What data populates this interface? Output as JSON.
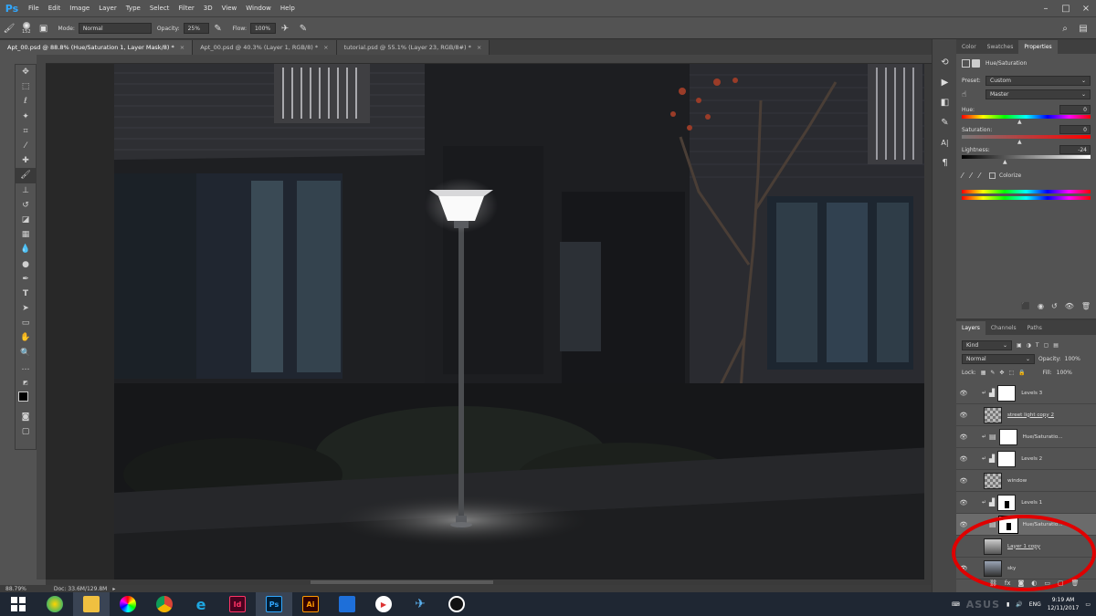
{
  "menubar": {
    "logo": "Ps",
    "items": [
      "File",
      "Edit",
      "Image",
      "Layer",
      "Type",
      "Select",
      "Filter",
      "3D",
      "View",
      "Window",
      "Help"
    ]
  },
  "options": {
    "brush_size": "152",
    "mode_label": "Mode:",
    "mode_value": "Normal",
    "opacity_label": "Opacity:",
    "opacity_value": "25%",
    "flow_label": "Flow:",
    "flow_value": "100%"
  },
  "tabs": [
    {
      "label": "Apt_00.psd @ 88.8% (Hue/Saturation 1, Layer Mask/8) *",
      "active": true
    },
    {
      "label": "Apt_00.psd @ 40.3% (Layer 1, RGB/8) *",
      "active": false
    },
    {
      "label": "tutorial.psd @ 55.1% (Layer 23, RGB/8#) *",
      "active": false
    }
  ],
  "status": {
    "zoom": "88.79%",
    "doc": "Doc: 33.6M/129.8M"
  },
  "properties": {
    "tabs": [
      "Color",
      "Swatches",
      "Properties"
    ],
    "title": "Hue/Saturation",
    "preset_label": "Preset:",
    "preset_value": "Custom",
    "channel_value": "Master",
    "hue_label": "Hue:",
    "hue_value": "0",
    "saturation_label": "Saturation:",
    "saturation_value": "0",
    "lightness_label": "Lightness:",
    "lightness_value": "-24",
    "colorize_label": "Colorize"
  },
  "layers_panel": {
    "tabs": [
      "Layers",
      "Channels",
      "Paths"
    ],
    "kind_label": "Kind",
    "blend_mode": "Normal",
    "opacity_label": "Opacity:",
    "opacity_value": "100%",
    "lock_label": "Lock:",
    "fill_label": "Fill:",
    "fill_value": "100%",
    "layers": [
      {
        "name": "Levels 3"
      },
      {
        "name": "street light copy 2"
      },
      {
        "name": "Hue/Saturatio..."
      },
      {
        "name": "Levels 2"
      },
      {
        "name": "window"
      },
      {
        "name": "Levels 1"
      },
      {
        "name": "Hue/Saturatio..."
      },
      {
        "name": "Layer 1 copy"
      },
      {
        "name": "sky"
      }
    ]
  },
  "taskbar": {
    "apps": [
      "Id",
      "Ps",
      "Ai"
    ],
    "lang": "ENG",
    "time": "9:19 AM",
    "date": "12/11/2017",
    "watermark": "ASUS"
  },
  "highlight_color": "#e00000"
}
